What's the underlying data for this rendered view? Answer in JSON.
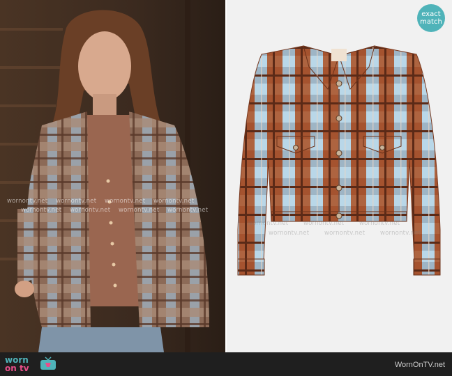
{
  "badge": {
    "line1": "exact",
    "line2": "match"
  },
  "watermark": "wornontv.net",
  "footer": {
    "logo_top": "worn",
    "logo_bottom": "on tv",
    "site": "WornOnTV.net"
  },
  "colors": {
    "brand_teal": "#4fb3b9",
    "brand_pink": "#e84f8a",
    "footer_bg": "#1f1f1f",
    "plaid_rust": "#a5532f",
    "plaid_blue": "#9cc7df"
  }
}
